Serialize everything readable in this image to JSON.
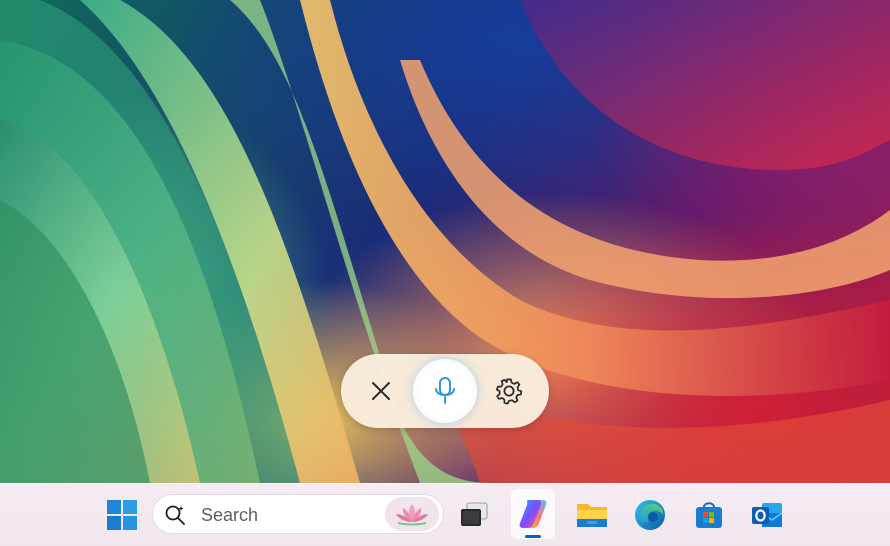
{
  "desktop": {
    "wallpaper_name": "bloom-wallpaper"
  },
  "voice_bar": {
    "close_icon": "close-icon",
    "mic_icon": "microphone-icon",
    "settings_icon": "gear-icon",
    "accent_color": "#2b9ad6"
  },
  "taskbar": {
    "start_icon": "windows-logo-icon",
    "search": {
      "placeholder": "Search",
      "highlight_icon": "lotus-icon"
    },
    "apps": [
      {
        "name": "task-view",
        "icon": "task-view-icon"
      },
      {
        "name": "copilot",
        "icon": "copilot-icon",
        "active": true
      },
      {
        "name": "file-explorer",
        "icon": "folder-icon"
      },
      {
        "name": "edge",
        "icon": "edge-icon"
      },
      {
        "name": "microsoft-store",
        "icon": "store-icon"
      },
      {
        "name": "outlook",
        "icon": "outlook-icon"
      }
    ]
  }
}
